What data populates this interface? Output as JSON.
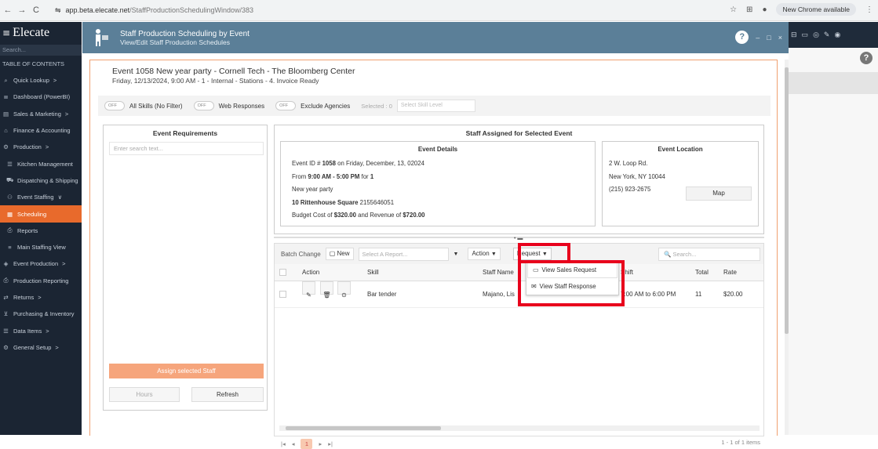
{
  "browser": {
    "url_domain": "app.beta.elecate.net",
    "url_path": "/StaffProductionSchedulingWindow/383",
    "chrome_update": "New Chrome available"
  },
  "sidebar": {
    "brand": "Elecate",
    "search_placeholder": "Search...",
    "toc_label": "TABLE OF CONTENTS",
    "items": [
      {
        "label": "Quick Lookup",
        "icon": "search-icon",
        "chevron": ">"
      },
      {
        "label": "Dashboard (PowerBI)",
        "icon": "dashboard-icon",
        "chevron": ""
      },
      {
        "label": "Sales & Marketing",
        "icon": "chart-icon",
        "chevron": ">"
      },
      {
        "label": "Finance & Accounting",
        "icon": "bank-icon",
        "chevron": ""
      },
      {
        "label": "Production",
        "icon": "gear-icon",
        "chevron": ">"
      },
      {
        "label": "Kitchen Management",
        "icon": "kitchen-icon",
        "chevron": "",
        "sub": true
      },
      {
        "label": "Dispatching & Shipping",
        "icon": "truck-icon",
        "chevron": "",
        "sub": true
      },
      {
        "label": "Event Staffing",
        "icon": "staff-icon",
        "chevron": "∨",
        "sub": true
      },
      {
        "label": "Scheduling",
        "icon": "calendar-icon",
        "chevron": "",
        "sub": true,
        "active": true
      },
      {
        "label": "Reports",
        "icon": "report-icon",
        "chevron": "",
        "sub": true
      },
      {
        "label": "Main Staffing View",
        "icon": "list-icon",
        "chevron": "",
        "sub": true
      },
      {
        "label": "Event Production",
        "icon": "event-icon",
        "chevron": ">"
      },
      {
        "label": "Production Reporting",
        "icon": "printer-icon",
        "chevron": ""
      },
      {
        "label": "Returns",
        "icon": "returns-icon",
        "chevron": ">"
      },
      {
        "label": "Purchasing & Inventory",
        "icon": "cart-icon",
        "chevron": ""
      },
      {
        "label": "Data Items",
        "icon": "database-icon",
        "chevron": ">"
      },
      {
        "label": "General Setup",
        "icon": "setup-icon",
        "chevron": ">"
      }
    ]
  },
  "dialog": {
    "title": "Staff Production Scheduling by Event",
    "subtitle": "View/Edit Staff Production Schedules",
    "event_title": "Event 1058 New year party - Cornell Tech - The Bloomberg Center",
    "event_subtitle": "Friday, 12/13/2024, 9:00 AM - 1 - Internal - Stations - 4. Invoice Ready"
  },
  "filters": {
    "toggle_off": "OFF",
    "all_skills": "All Skills (No Filter)",
    "web_responses": "Web Responses",
    "exclude_agencies": "Exclude Agencies",
    "selected": "Selected : 0",
    "skill_level_placeholder": "Select Skill Level"
  },
  "left_panel": {
    "title": "Event Requirements",
    "search_placeholder": "Enter search text...",
    "assign_button": "Assign selected Staff",
    "hours_button": "Hours",
    "refresh_button": "Refresh"
  },
  "right_panel": {
    "title": "Staff Assigned for Selected Event",
    "details": {
      "title": "Event Details",
      "line1_a": "Event ID # ",
      "line1_b": "1058",
      "line1_c": " on Friday, December, 13, 02024",
      "line2_a": "From ",
      "line2_b": "9:00 AM - 5:00 PM",
      "line2_c": " for ",
      "line2_d": "1",
      "line3": "New year party",
      "line4_a": "10 Rittenhouse Square",
      "line4_b": " 2155646051",
      "line5_a": "Budget Cost of ",
      "line5_b": "$320.00",
      "line5_c": " and Revenue of ",
      "line5_d": "$720.00"
    },
    "location": {
      "title": "Event Location",
      "line1": "2 W. Loop Rd.",
      "line2": "New York, NY 10044",
      "line3": "(215) 923-2675",
      "map_button": "Map"
    }
  },
  "grid": {
    "batch_change": "Batch Change",
    "new_button": "New",
    "report_placeholder": "Select A Report...",
    "action": "Action",
    "request": "Request",
    "search_placeholder": "Search...",
    "columns": {
      "action": "Action",
      "skill": "Skill",
      "staff_name": "Staff Name",
      "shift": "Shift",
      "total": "Total",
      "rate": "Rate"
    },
    "rows": [
      {
        "skill": "Bar tender",
        "staff_name": "Majano, Lis",
        "shift": "7:00 AM to 6:00 PM",
        "total": "11",
        "rate": "$20.00"
      }
    ],
    "dropdown": {
      "view_sales_request": "View Sales Request",
      "view_staff_response": "View Staff Response"
    },
    "pager": {
      "current": "1",
      "info": "1 - 1 of 1 items"
    }
  },
  "colors": {
    "header": "#5b7f98",
    "sidebar": "#1b2533",
    "active": "#e86a2c",
    "assign": "#f6a57c",
    "highlight": "#e8001c"
  }
}
